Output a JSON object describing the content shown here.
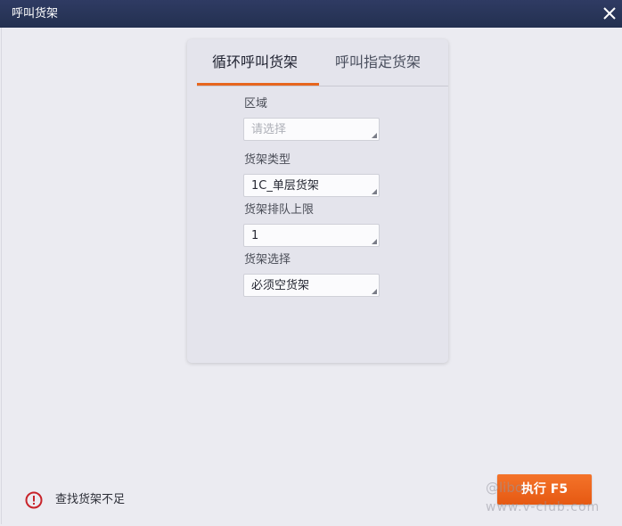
{
  "window": {
    "title": "呼叫货架",
    "close_icon": "close-icon"
  },
  "tabs": [
    {
      "label": "循环呼叫货架",
      "active": true
    },
    {
      "label": "呼叫指定货架",
      "active": false
    }
  ],
  "form": {
    "area": {
      "label": "区域",
      "placeholder": "请选择",
      "value": ""
    },
    "shelf_type": {
      "label": "货架类型",
      "value": "1C_单层货架"
    },
    "queue_limit": {
      "label": "货架排队上限",
      "value": "1"
    },
    "shelf_select": {
      "label": "货架选择",
      "value": "必须空货架"
    }
  },
  "status": {
    "icon": "error-circle-icon",
    "message": "查找货架不足",
    "color": "#c8242b"
  },
  "actions": {
    "execute_label": "执行 F5",
    "accent": "#ec651c"
  },
  "watermark": {
    "line1": "@libo...",
    "line2": "www.v-club.com"
  }
}
